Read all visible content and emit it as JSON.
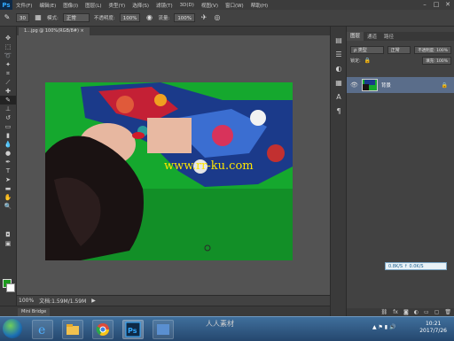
{
  "app": {
    "logo": "Ps",
    "name": "Adobe Photoshop CS6"
  },
  "menu": [
    "文件(F)",
    "编辑(E)",
    "图像(I)",
    "图层(L)",
    "类型(Y)",
    "选择(S)",
    "滤镜(T)",
    "3D(D)",
    "视图(V)",
    "窗口(W)",
    "帮助(H)"
  ],
  "options_bar": {
    "tool_icon": "brush-icon",
    "size": "30",
    "mode_label": "模式:",
    "mode_value": "正常",
    "opacity_label": "不透明度:",
    "opacity_value": "100%",
    "flow_label": "流量:",
    "flow_value": "100%"
  },
  "document": {
    "tab_title": "1...jpg @ 100%(RGB/8#)",
    "watermark": "www.rr-ku.com",
    "zoom": "100%",
    "status_doc": "文档:1.59M/1.59M",
    "bottom_tab": "Mini Bridge"
  },
  "panel": {
    "tabs": [
      "图层",
      "通道",
      "路径"
    ],
    "kind_label": "ρ 类型",
    "blend_mode": "正常",
    "opacity": "不透明度: 100%",
    "lock_label": "锁定:",
    "fill": "填充: 100%",
    "layer_name": "背景",
    "notice": "0.8K/S ↑ 0.0K/S"
  },
  "taskbar": {
    "time": "10:21",
    "date": "2017/7/26",
    "brand": "人人素材"
  },
  "colors": {
    "foreground": "#1e9a1e",
    "background": "#ffffff",
    "canvas_bg": "#15a82e",
    "watermark": "#ffe600"
  }
}
